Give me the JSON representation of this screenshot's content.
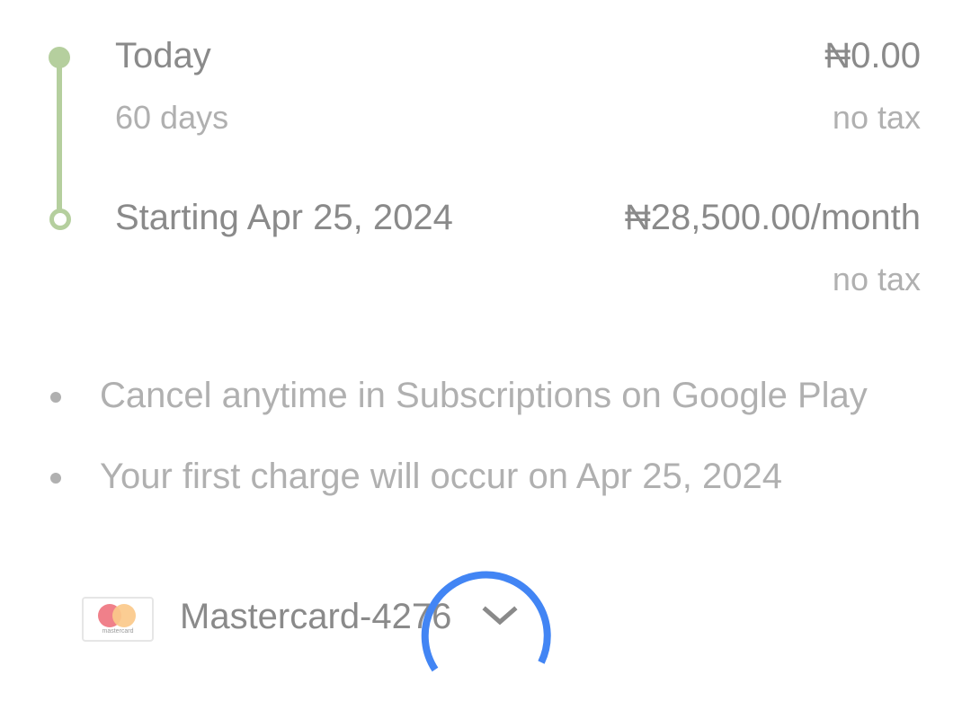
{
  "timeline": {
    "today": {
      "label": "Today",
      "price": "₦0.00",
      "duration": "60 days",
      "tax": "no tax"
    },
    "starting": {
      "label": "Starting Apr 25, 2024",
      "price": "₦28,500.00/month",
      "tax": "no tax"
    }
  },
  "notes": [
    "Cancel anytime in Subscriptions on Google Play",
    "Your first charge will occur on Apr 25, 2024"
  ],
  "payment": {
    "card_brand_small": "mastercard",
    "method_label": "Mastercard-4276"
  },
  "colors": {
    "timeline_accent": "#b5cf9e",
    "spinner": "#4285f4"
  },
  "icons": {
    "start": "timeline-filled-dot-icon",
    "end": "timeline-ring-dot-icon",
    "card": "mastercard-logo-icon",
    "dropdown": "chevron-down-icon",
    "loading": "loading-spinner-icon"
  }
}
